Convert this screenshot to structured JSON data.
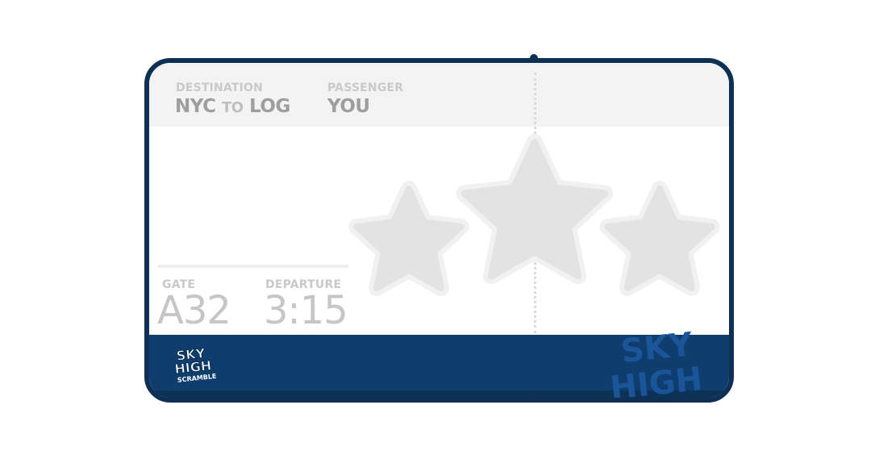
{
  "ticket": {
    "destination_label": "DESTINATION",
    "origin": "NYC",
    "to_word": "TO",
    "destination": "LOG",
    "passenger_label": "PASSENGER",
    "passenger": "YOU",
    "gate_label": "GATE",
    "gate": "A32",
    "departure_label": "DEPARTURE",
    "departure": "3:15"
  },
  "stars": {
    "earned": 0,
    "total": 3
  },
  "logo": {
    "line1": "SKY",
    "line2": "HIGH",
    "line3": "SCRAMBLE"
  },
  "watermark": {
    "line1": "SKY",
    "line2": "HIGH"
  },
  "colors": {
    "ticket_border": "#0f3054",
    "footer": "#0e3d6e",
    "header_bg": "#f3f3f3",
    "star_fill": "#e3e3e3",
    "star_outline": "#f1f1f1"
  }
}
